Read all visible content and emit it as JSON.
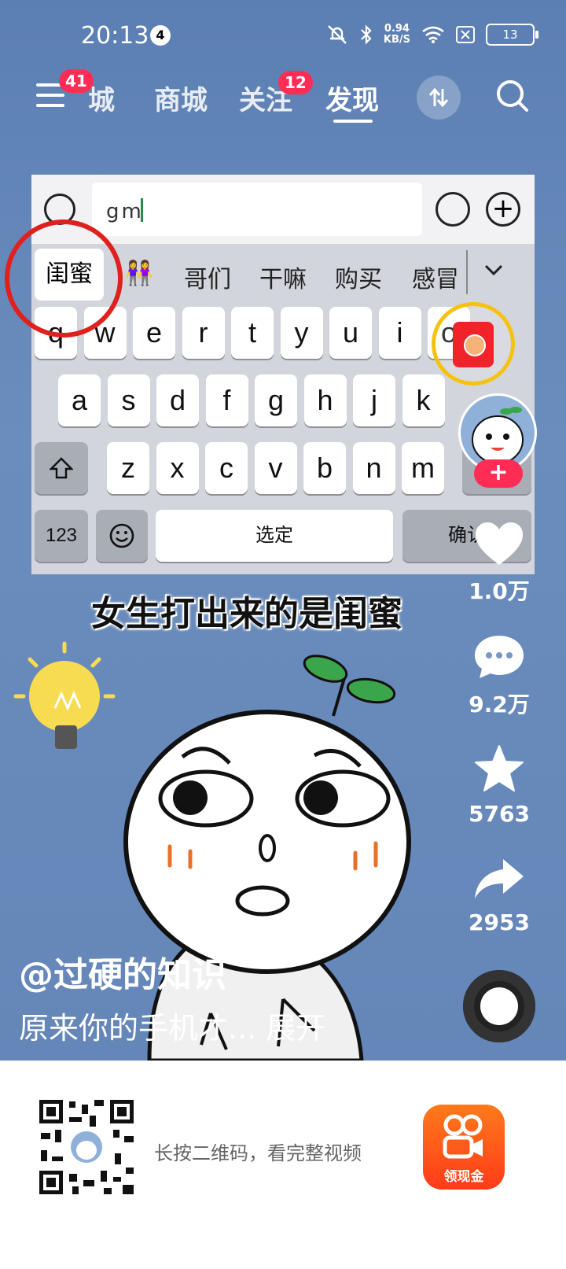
{
  "status_bar": {
    "time": "20:13",
    "notification_count": "4",
    "net_speed_value": "0.94",
    "net_speed_unit": "KB/S",
    "battery": "13"
  },
  "nav": {
    "menu_badge": "41",
    "tabs": [
      {
        "label": "城"
      },
      {
        "label": "商城"
      },
      {
        "label": "关注"
      },
      {
        "label": "发现"
      }
    ],
    "follow_badge": "12",
    "active_tab": "发现"
  },
  "keyboard": {
    "input_text": "gm",
    "candidates": [
      "闺蜜",
      "👭",
      "哥们",
      "干嘛",
      "购买",
      "感冒"
    ],
    "row1": [
      "q",
      "w",
      "e",
      "r",
      "t",
      "y",
      "u",
      "i",
      "o"
    ],
    "row2": [
      "a",
      "s",
      "d",
      "f",
      "g",
      "h",
      "j",
      "k"
    ],
    "row3": [
      "z",
      "x",
      "c",
      "v",
      "b",
      "n",
      "m"
    ],
    "num_key": "123",
    "space_key": "选定",
    "confirm_key": "确认"
  },
  "caption": "女生打出来的是闺蜜",
  "actions": {
    "likes": "1.0万",
    "comments": "9.2万",
    "favorites": "5763",
    "shares": "2953"
  },
  "author": "@过硬的知识",
  "description": "原来你的手机才... 展开",
  "bottom": {
    "hint": "长按二维码，看完整视频",
    "app_logo_label": "领现金"
  },
  "colors": {
    "accent": "#ff2d55",
    "highlight_circle": "#e0201e",
    "background": "#6a8cbc"
  }
}
